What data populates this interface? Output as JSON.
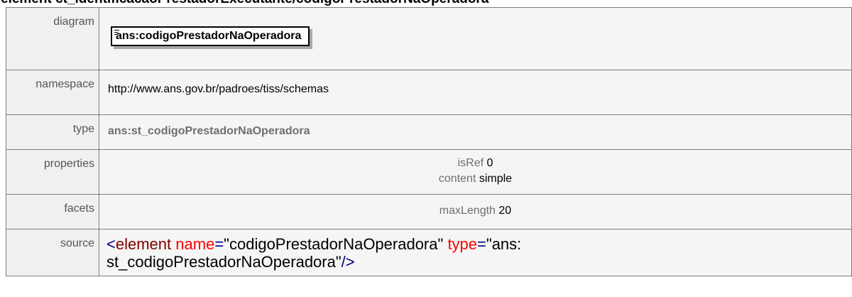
{
  "page_title": "element ct_identificacaoPrestadorExecutante/codigoPrestadorNaOperadora",
  "rows": {
    "diagram": {
      "label": "diagram",
      "element_name": "ans:codigoPrestadorNaOperadora"
    },
    "namespace": {
      "label": "namespace",
      "value": "http://www.ans.gov.br/padroes/tiss/schemas"
    },
    "type": {
      "label": "type",
      "value": "ans:st_codigoPrestadorNaOperadora"
    },
    "properties": {
      "label": "properties",
      "items": [
        {
          "key": "isRef",
          "value": "0"
        },
        {
          "key": "content",
          "value": "simple"
        }
      ]
    },
    "facets": {
      "label": "facets",
      "items": [
        {
          "key": "maxLength",
          "value": "20"
        }
      ]
    },
    "source": {
      "label": "source",
      "open_bracket": "<",
      "element_tag": "element",
      "attr1_name": "name",
      "attr1_eq": "=",
      "attr1_value": "\"codigoPrestadorNaOperadora\"",
      "attr2_name": "type",
      "attr2_eq": "=",
      "attr2_value_line1": "\"ans:",
      "attr2_value_line2": "st_codigoPrestadorNaOperadora\"",
      "close": "/>"
    }
  }
}
